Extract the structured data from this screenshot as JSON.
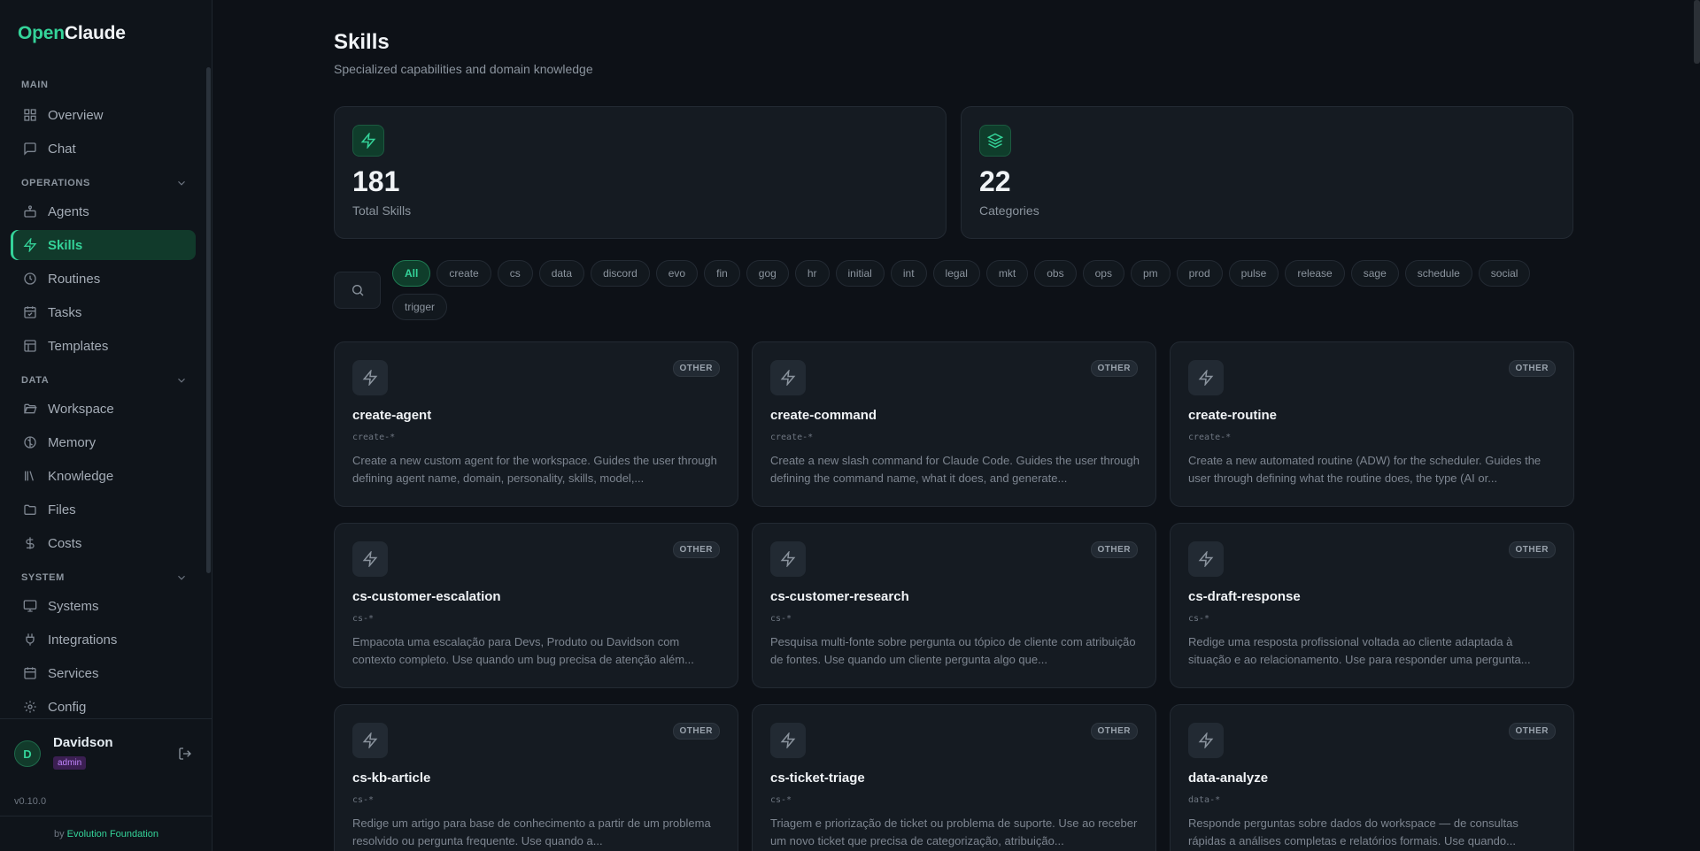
{
  "app": {
    "logo_open": "Open",
    "logo_claude": "Claude"
  },
  "sidebar": {
    "sections": {
      "main": "MAIN",
      "operations": "OPERATIONS",
      "data": "DATA",
      "system": "SYSTEM"
    },
    "items": [
      {
        "label": "Overview",
        "icon": "grid-icon"
      },
      {
        "label": "Chat",
        "icon": "chat-icon"
      },
      {
        "label": "Agents",
        "icon": "bot-icon"
      },
      {
        "label": "Skills",
        "icon": "zap-icon",
        "active": true
      },
      {
        "label": "Routines",
        "icon": "clock-icon"
      },
      {
        "label": "Tasks",
        "icon": "calendar-check-icon"
      },
      {
        "label": "Templates",
        "icon": "layout-icon"
      },
      {
        "label": "Workspace",
        "icon": "folder-open-icon"
      },
      {
        "label": "Memory",
        "icon": "brain-icon"
      },
      {
        "label": "Knowledge",
        "icon": "library-icon"
      },
      {
        "label": "Files",
        "icon": "folder-icon"
      },
      {
        "label": "Costs",
        "icon": "dollar-icon"
      },
      {
        "label": "Systems",
        "icon": "monitor-icon"
      },
      {
        "label": "Integrations",
        "icon": "plug-icon"
      },
      {
        "label": "Services",
        "icon": "calendar-icon"
      },
      {
        "label": "Config",
        "icon": "gear-icon"
      }
    ],
    "user": {
      "initial": "D",
      "name": "Davidson",
      "role": "admin"
    },
    "version": "v0.10.0",
    "footer_by": "by",
    "footer_brand": "Evolution Foundation"
  },
  "page": {
    "title": "Skills",
    "subtitle": "Specialized capabilities and domain knowledge"
  },
  "stats": [
    {
      "value": "181",
      "label": "Total Skills",
      "icon": "zap-icon"
    },
    {
      "value": "22",
      "label": "Categories",
      "icon": "layers-icon"
    }
  ],
  "filters": [
    "All",
    "create",
    "cs",
    "data",
    "discord",
    "evo",
    "fin",
    "gog",
    "hr",
    "initial",
    "int",
    "legal",
    "mkt",
    "obs",
    "ops",
    "pm",
    "prod",
    "pulse",
    "release",
    "sage",
    "schedule",
    "social",
    "trigger"
  ],
  "active_filter": "All",
  "cards": [
    {
      "name": "create-agent",
      "pattern": "create-*",
      "badge": "OTHER",
      "desc": "Create a new custom agent for the workspace. Guides the user through defining agent name, domain, personality, skills, model,..."
    },
    {
      "name": "create-command",
      "pattern": "create-*",
      "badge": "OTHER",
      "desc": "Create a new slash command for Claude Code. Guides the user through defining the command name, what it does, and generate..."
    },
    {
      "name": "create-routine",
      "pattern": "create-*",
      "badge": "OTHER",
      "desc": "Create a new automated routine (ADW) for the scheduler. Guides the user through defining what the routine does, the type (AI or..."
    },
    {
      "name": "cs-customer-escalation",
      "pattern": "cs-*",
      "badge": "OTHER",
      "desc": "Empacota uma escalação para Devs, Produto ou Davidson com contexto completo. Use quando um bug precisa de atenção além..."
    },
    {
      "name": "cs-customer-research",
      "pattern": "cs-*",
      "badge": "OTHER",
      "desc": "Pesquisa multi-fonte sobre pergunta ou tópico de cliente com atribuição de fontes. Use quando um cliente pergunta algo que..."
    },
    {
      "name": "cs-draft-response",
      "pattern": "cs-*",
      "badge": "OTHER",
      "desc": "Redige uma resposta profissional voltada ao cliente adaptada à situação e ao relacionamento. Use para responder uma pergunta..."
    },
    {
      "name": "cs-kb-article",
      "pattern": "cs-*",
      "badge": "OTHER",
      "desc": "Redige um artigo para base de conhecimento a partir de um problema resolvido ou pergunta frequente. Use quando a..."
    },
    {
      "name": "cs-ticket-triage",
      "pattern": "cs-*",
      "badge": "OTHER",
      "desc": "Triagem e priorização de ticket ou problema de suporte. Use ao receber um novo ticket que precisa de categorização, atribuição..."
    },
    {
      "name": "data-analyze",
      "pattern": "data-*",
      "badge": "OTHER",
      "desc": "Responde perguntas sobre dados do workspace — de consultas rápidas a análises completas e relatórios formais. Use quando..."
    }
  ]
}
